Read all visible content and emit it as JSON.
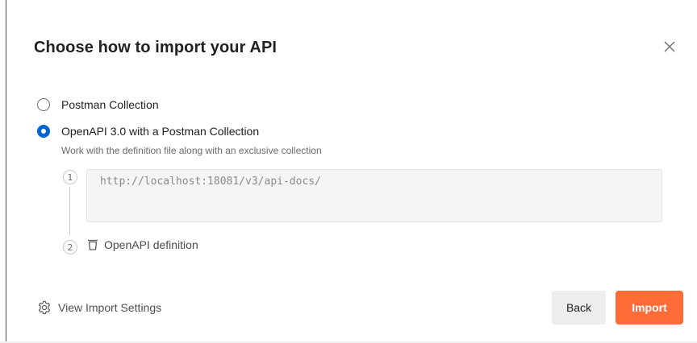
{
  "dialog": {
    "title": "Choose how to import your API"
  },
  "options": [
    {
      "label": "Postman Collection",
      "selected": false
    },
    {
      "label": "OpenAPI 3.0 with a Postman Collection",
      "selected": true,
      "description": "Work with the definition file along with an exclusive collection"
    }
  ],
  "steps": [
    {
      "number": "1",
      "value": "http://localhost:18081/v3/api-docs/"
    },
    {
      "number": "2",
      "label": "OpenAPI definition",
      "icon": "trash-icon"
    }
  ],
  "footer": {
    "settings_label": "View Import Settings",
    "settings_icon": "gear-icon",
    "back_label": "Back",
    "import_label": "Import"
  },
  "colors": {
    "accent": "#ff6c37",
    "radio_selected": "#0265d2"
  }
}
